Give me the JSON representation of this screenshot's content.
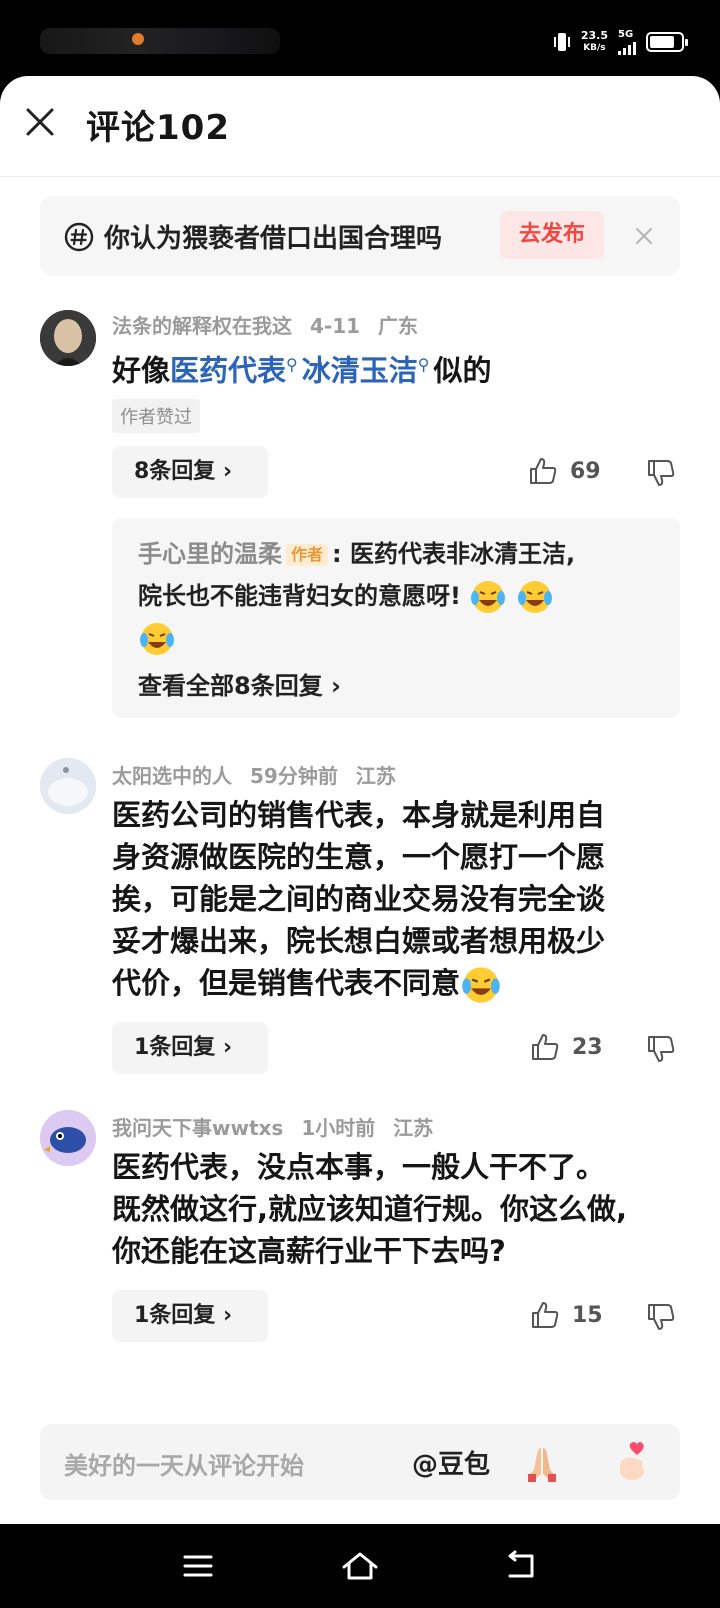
{
  "status_bar": {
    "speed_value": "23.5",
    "speed_unit": "KB/s",
    "network": "5G"
  },
  "header": {
    "title": "评论102"
  },
  "prompt": {
    "text": "你认为猥亵者借口出国合理吗",
    "button": "去发布"
  },
  "comments": [
    {
      "user": "法条的解释权在我这",
      "date": "4-11",
      "region": "广东",
      "text_pre": "好像",
      "link1": "医药代表",
      "link2": "冰清玉洁",
      "text_post": "似的",
      "tag": "作者赞过",
      "replies": "8条回复",
      "likes": "69",
      "reply": {
        "name": "手心里的温柔",
        "author_tag": "作者",
        "line1": ": 医药代表非冰清王洁,",
        "line2": "院长也不能违背妇女的意愿呀!",
        "view_all": "查看全部8条回复"
      }
    },
    {
      "user": "太阳选中的人",
      "date": "59分钟前",
      "region": "江苏",
      "lines": [
        "医药公司的销售代表，本身就是利用自",
        "身资源做医院的生意，一个愿打一个愿",
        "挨，可能是之间的商业交易没有完全谈",
        "妥才爆出来，院长想白嫖或者想用极少",
        "代价，但是销售代表不同意"
      ],
      "replies": "1条回复",
      "likes": "23"
    },
    {
      "user": "我问天下事wwtxs",
      "date": "1小时前",
      "region": "江苏",
      "lines": [
        "医药代表，没点本事，一般人干不了。",
        "既然做这行,就应该知道行规。你这么做,",
        "你还能在这高薪行业干下去吗?"
      ],
      "replies": "1条回复",
      "likes": "15"
    }
  ],
  "input": {
    "placeholder": "美好的一天从评论开始",
    "mention": "@豆包"
  },
  "colors": {
    "link": "#2c64b8",
    "publish": "#f0473f"
  }
}
